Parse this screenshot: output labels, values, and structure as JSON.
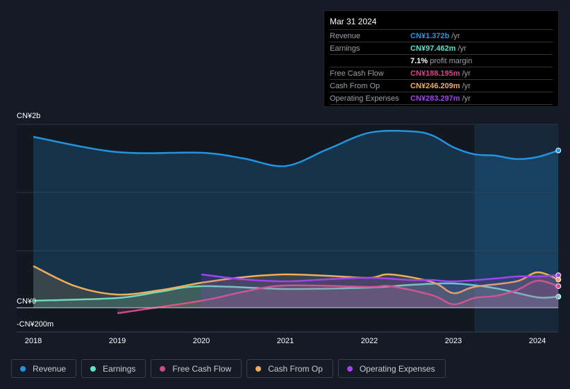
{
  "tooltip": {
    "date": "Mar 31 2024",
    "rows": [
      {
        "label": "Revenue",
        "value": "CN¥1.372b",
        "unit": "/yr",
        "color": "#2394df"
      },
      {
        "label": "Earnings",
        "value": "CN¥97.462m",
        "unit": "/yr",
        "color": "#59e3cf"
      },
      {
        "label": "",
        "value": "7.1%",
        "unit": "profit margin",
        "color": "#ffffff"
      },
      {
        "label": "Free Cash Flow",
        "value": "CN¥188.195m",
        "unit": "/yr",
        "color": "#d4478a"
      },
      {
        "label": "Cash From Op",
        "value": "CN¥246.209m",
        "unit": "/yr",
        "color": "#eeae5a"
      },
      {
        "label": "Operating Expenses",
        "value": "CN¥283.297m",
        "unit": "/yr",
        "color": "#a343f0"
      }
    ]
  },
  "chart_data": {
    "type": "line",
    "y_tick_labels": [
      "CN¥2b",
      "CN¥0",
      "-CN¥200m"
    ],
    "x_tick_labels": [
      "2018",
      "2019",
      "2020",
      "2021",
      "2022",
      "2023",
      "2024"
    ],
    "xlim": [
      2017.8,
      2024.25
    ],
    "ylim": [
      -200,
      1600
    ],
    "highlight_from": 2023.25,
    "series": [
      {
        "name": "Revenue",
        "color": "#2394df",
        "fill": true,
        "x": [
          2018,
          2019,
          2020,
          2020.5,
          2021,
          2021.5,
          2022,
          2022.5,
          2022.75,
          2023,
          2023.25,
          2023.5,
          2023.75,
          2024,
          2024.25
        ],
        "values": [
          1491,
          1358,
          1352,
          1303,
          1236,
          1382,
          1527,
          1539,
          1503,
          1400,
          1339,
          1327,
          1297,
          1315,
          1372
        ]
      },
      {
        "name": "Earnings",
        "color": "#59e3cf",
        "fill": true,
        "x": [
          2018,
          2019,
          2019.5,
          2020,
          2021,
          2022,
          2022.5,
          2023,
          2023.5,
          2024,
          2024.25
        ],
        "values": [
          61,
          85,
          139,
          188,
          164,
          176,
          200,
          212,
          170,
          91,
          97
        ]
      },
      {
        "name": "Free Cash Flow",
        "color": "#d4478a",
        "fill": true,
        "x": [
          2019,
          2020,
          2020.5,
          2021,
          2022,
          2022.25,
          2022.75,
          2023,
          2023.25,
          2023.5,
          2023.75,
          2024,
          2024.25
        ],
        "values": [
          -48,
          61,
          139,
          194,
          182,
          188,
          109,
          30,
          85,
          103,
          152,
          236,
          188
        ]
      },
      {
        "name": "Cash From Op",
        "color": "#eeae5a",
        "fill": true,
        "x": [
          2018,
          2018.5,
          2019,
          2019.5,
          2020,
          2020.5,
          2021,
          2021.5,
          2022,
          2022.25,
          2022.75,
          2023,
          2023.25,
          2023.75,
          2024,
          2024.25
        ],
        "values": [
          364,
          188,
          115,
          152,
          218,
          267,
          291,
          279,
          261,
          291,
          224,
          127,
          182,
          230,
          309,
          246
        ]
      },
      {
        "name": "Operating Expenses",
        "color": "#a343f0",
        "fill": true,
        "x": [
          2020,
          2020.5,
          2021,
          2021.5,
          2022,
          2022.5,
          2022.75,
          2023,
          2023.5,
          2023.75,
          2024,
          2024.25
        ],
        "values": [
          291,
          248,
          230,
          248,
          261,
          242,
          242,
          230,
          255,
          273,
          273,
          283
        ]
      }
    ]
  },
  "legend": [
    "Revenue",
    "Earnings",
    "Free Cash Flow",
    "Cash From Op",
    "Operating Expenses"
  ]
}
